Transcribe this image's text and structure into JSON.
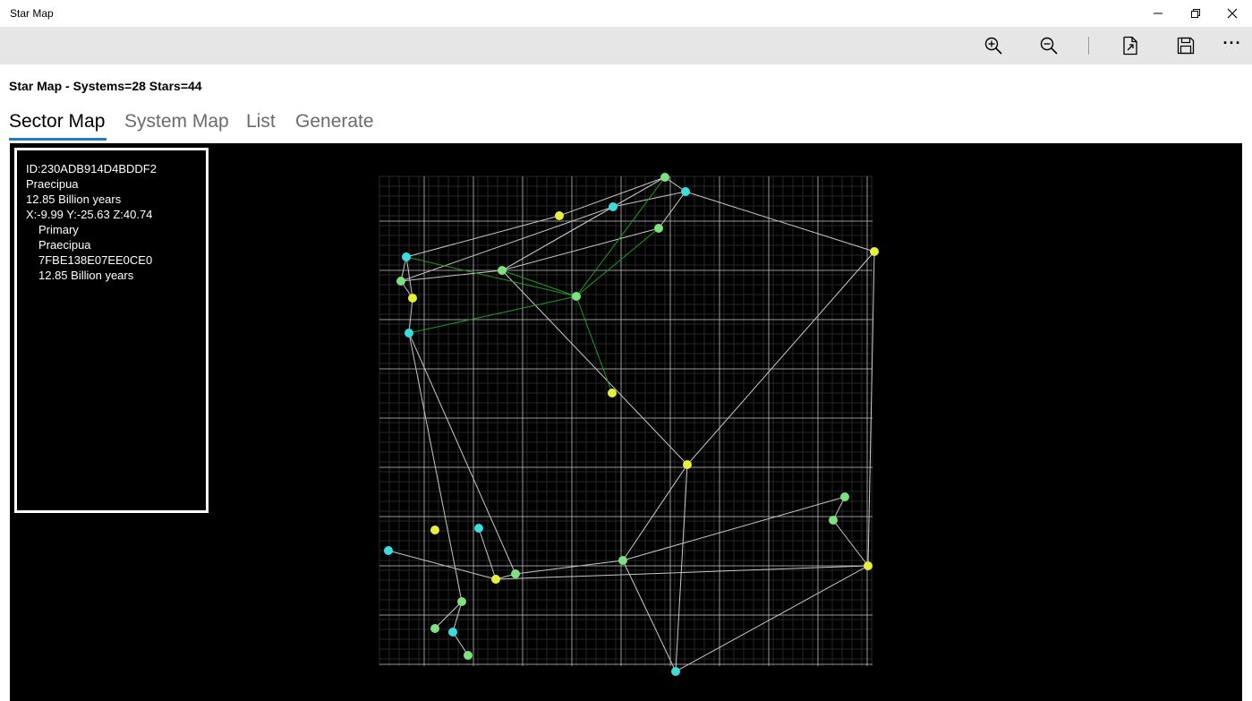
{
  "window": {
    "title": "Star Map"
  },
  "toolbar": {
    "buttons": [
      "zoom-in-icon",
      "zoom-out-icon",
      "export-file-icon",
      "save-icon"
    ],
    "more_label": "···"
  },
  "page_title": "Star Map - Systems=28 Stars=44",
  "tabs": [
    {
      "label": "Sector Map",
      "active": true
    },
    {
      "label": "System Map",
      "active": false
    },
    {
      "label": "List",
      "active": false
    },
    {
      "label": "Generate",
      "active": false
    }
  ],
  "info_panel": {
    "lines": [
      "ID:230ADB914D4BDDF2",
      "Praecipua",
      "12.85 Billion years",
      "X:-9.99 Y:-25.63 Z:40.74",
      "Primary",
      "Praecipua",
      "7FBE138E07EE0CE0",
      "12.85 Billion years"
    ]
  },
  "colors": {
    "yellow_star": "#e6f03c",
    "green_star": "#7ee07e",
    "cyan_star": "#3cdcdc",
    "white_link": "#c8c8c8",
    "green_link": "#1f9a1f",
    "grid": "#c8c8c8",
    "tab_accent": "#2a7bbd"
  }
}
